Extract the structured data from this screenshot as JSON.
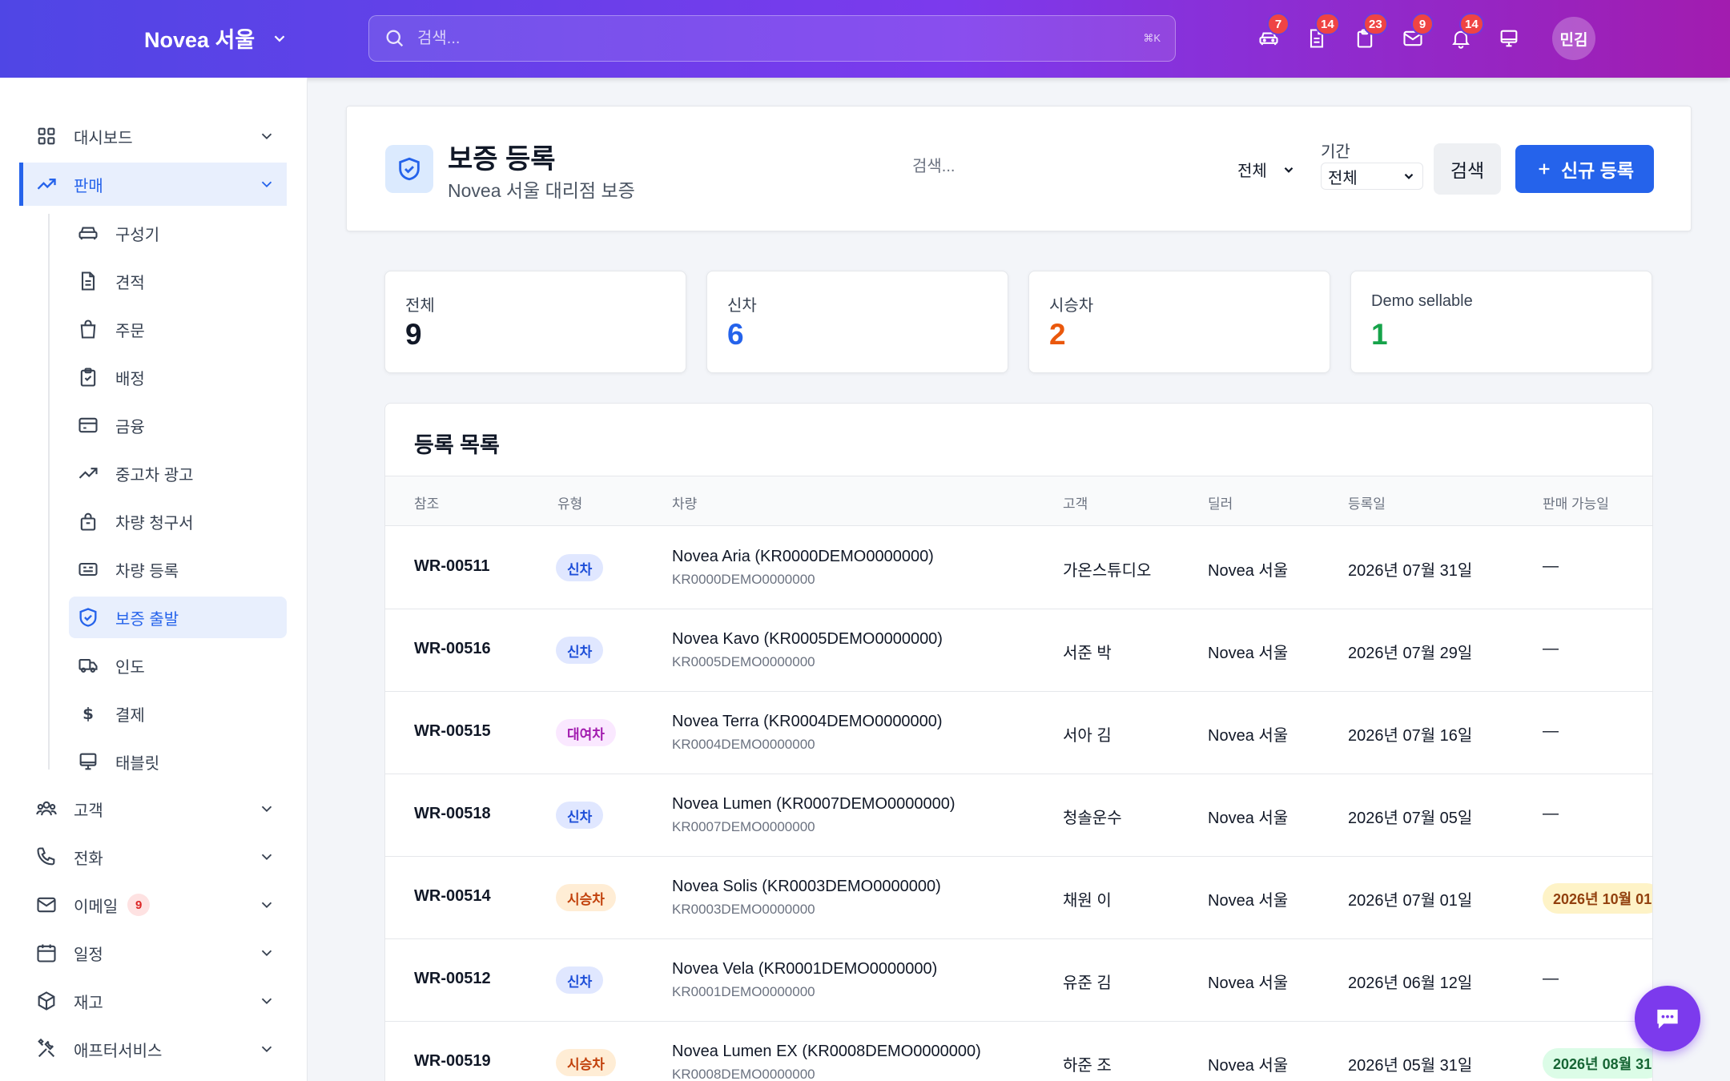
{
  "topbar": {
    "brand": "Novea 서울",
    "search_placeholder": "검색...",
    "shortcut": "⌘K",
    "icons": [
      {
        "name": "car-icon",
        "badge": "7"
      },
      {
        "name": "document-icon",
        "badge": "14"
      },
      {
        "name": "clipboard-icon",
        "badge": "23"
      },
      {
        "name": "mail-icon",
        "badge": "9"
      },
      {
        "name": "bell-icon",
        "badge": "14"
      },
      {
        "name": "monitor-icon",
        "badge": ""
      }
    ],
    "avatar": "민김"
  },
  "sidebar": {
    "items": [
      {
        "label": "대시보드",
        "icon": "grid-icon"
      },
      {
        "label": "판매",
        "icon": "trending-up-icon"
      },
      {
        "label": "고객",
        "icon": "users-icon"
      },
      {
        "label": "전화",
        "icon": "phone-icon"
      },
      {
        "label": "이메일",
        "icon": "mail-icon",
        "badge": "9"
      },
      {
        "label": "일정",
        "icon": "calendar-icon"
      },
      {
        "label": "재고",
        "icon": "box-icon"
      },
      {
        "label": "애프터서비스",
        "icon": "tools-icon"
      }
    ],
    "sales_sub": [
      {
        "label": "구성기",
        "icon": "car-icon"
      },
      {
        "label": "견적",
        "icon": "document-icon"
      },
      {
        "label": "주문",
        "icon": "shopping-bag-icon"
      },
      {
        "label": "배정",
        "icon": "clipboard-check-icon"
      },
      {
        "label": "금융",
        "icon": "credit-card-icon"
      },
      {
        "label": "중고차 광고",
        "icon": "trending-up-icon"
      },
      {
        "label": "차량 청구서",
        "icon": "lock-bag-icon"
      },
      {
        "label": "차량 등록",
        "icon": "id-card-icon"
      },
      {
        "label": "보증 출발",
        "icon": "shield-check-icon"
      },
      {
        "label": "인도",
        "icon": "truck-icon"
      },
      {
        "label": "결제",
        "icon": "dollar-icon"
      },
      {
        "label": "태블릿",
        "icon": "monitor-icon"
      }
    ]
  },
  "header": {
    "title": "보증 등록",
    "subtitle": "Novea 서울 대리점 보증",
    "search_placeholder": "검색...",
    "type_filter": "전체",
    "period_label": "기간",
    "period_value": "전체",
    "search_button": "검색",
    "new_button": "신규 등록"
  },
  "stats": [
    {
      "label": "전체",
      "value": "9",
      "color": "#111827"
    },
    {
      "label": "신차",
      "value": "6",
      "color": "#2563eb"
    },
    {
      "label": "시승차",
      "value": "2",
      "color": "#ea580c"
    },
    {
      "label": "Demo sellable",
      "value": "1",
      "color": "#16a34a"
    }
  ],
  "table": {
    "title": "등록 목록",
    "columns": [
      "참조",
      "유형",
      "차량",
      "고객",
      "딜러",
      "등록일",
      "판매 가능일"
    ],
    "rows": [
      {
        "ref": "WR-00511",
        "type": "신차",
        "vehicle": "Novea Aria (KR0000DEMO0000000)",
        "vin": "KR0000DEMO0000000",
        "customer": "가온스튜디오",
        "dealer": "Novea 서울",
        "date": "2026년 07월 31일",
        "available": "—"
      },
      {
        "ref": "WR-00516",
        "type": "신차",
        "vehicle": "Novea Kavo (KR0005DEMO0000000)",
        "vin": "KR0005DEMO0000000",
        "customer": "서준 박",
        "dealer": "Novea 서울",
        "date": "2026년 07월 29일",
        "available": "—"
      },
      {
        "ref": "WR-00515",
        "type": "대여차",
        "vehicle": "Novea Terra (KR0004DEMO0000000)",
        "vin": "KR0004DEMO0000000",
        "customer": "서아 김",
        "dealer": "Novea 서울",
        "date": "2026년 07월 16일",
        "available": "—"
      },
      {
        "ref": "WR-00518",
        "type": "신차",
        "vehicle": "Novea Lumen (KR0007DEMO0000000)",
        "vin": "KR0007DEMO0000000",
        "customer": "청솔운수",
        "dealer": "Novea 서울",
        "date": "2026년 07월 05일",
        "available": "—"
      },
      {
        "ref": "WR-00514",
        "type": "시승차",
        "vehicle": "Novea Solis (KR0003DEMO0000000)",
        "vin": "KR0003DEMO0000000",
        "customer": "채원 이",
        "dealer": "Novea 서울",
        "date": "2026년 07월 01일",
        "available": "2026년 10월 01"
      },
      {
        "ref": "WR-00512",
        "type": "신차",
        "vehicle": "Novea Vela (KR0001DEMO0000000)",
        "vin": "KR0001DEMO0000000",
        "customer": "유준 김",
        "dealer": "Novea 서울",
        "date": "2026년 06월 12일",
        "available": "—"
      },
      {
        "ref": "WR-00519",
        "type": "시승차",
        "vehicle": "Novea Lumen EX (KR0008DEMO0000000)",
        "vin": "KR0008DEMO0000000",
        "customer": "하준 조",
        "dealer": "Novea 서울",
        "date": "2026년 05월 31일",
        "available": "2026년 08월 31"
      }
    ]
  },
  "colors": {
    "primary": "#2563eb",
    "accent": "#7c3aed",
    "badge": "#ef4444"
  }
}
